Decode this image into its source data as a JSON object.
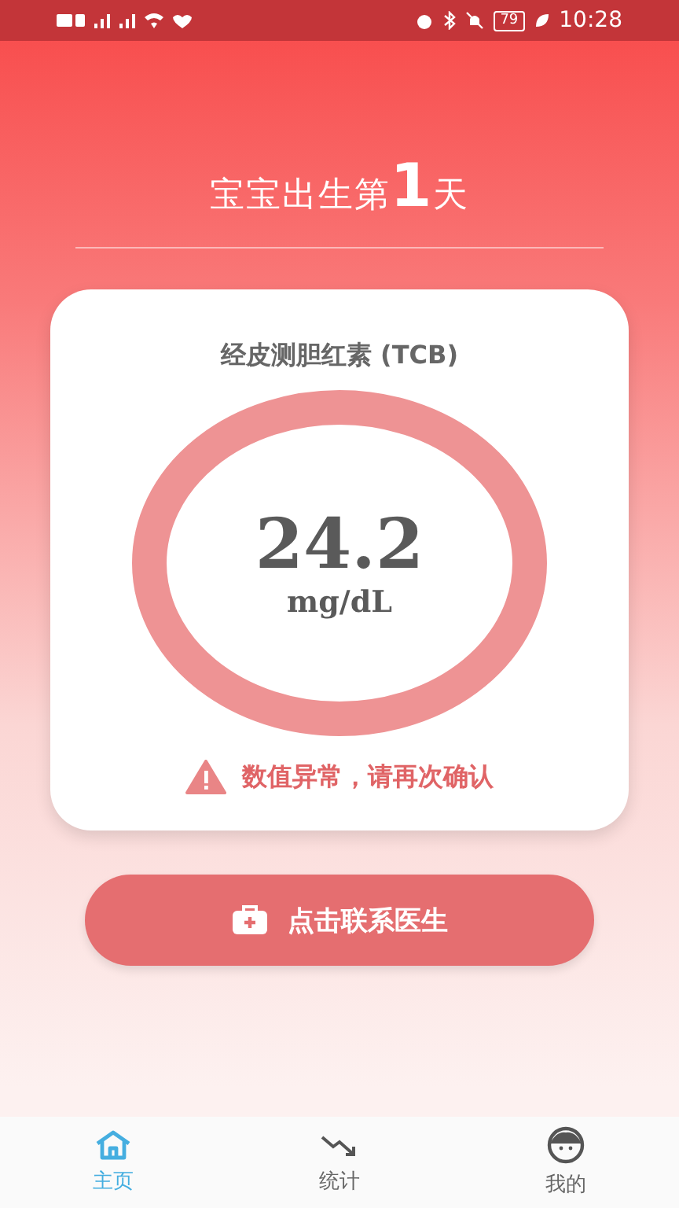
{
  "status_bar": {
    "battery": "79",
    "time": "10:28"
  },
  "title": "宝宝出生第**1**天",
  "card": {
    "title": "经皮测胆红素 (TCB)",
    "value": "24.2",
    "unit": "mg/dL",
    "warning": "数值异常，请再次确认"
  },
  "contact_button": "点击联系医生",
  "tabs": [
    {
      "kind": "home",
      "label": "主页",
      "selected": true
    },
    {
      "kind": "stats",
      "label": "统计",
      "selected": false
    },
    {
      "kind": "profile",
      "label": "我的",
      "selected": false
    }
  ]
}
